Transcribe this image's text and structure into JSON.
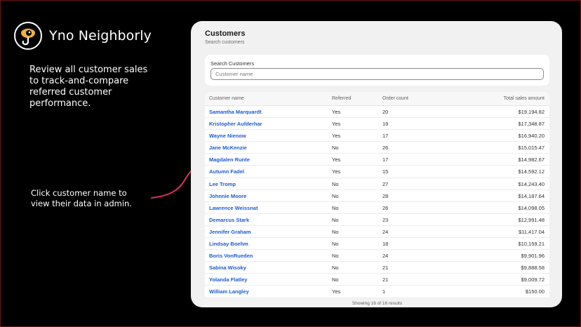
{
  "brand": {
    "name": "Yno Neighborly"
  },
  "intro": {
    "text": "Review all customer sales to track-and-compare referred customer performance."
  },
  "hint": {
    "text": "Click customer name to view their data in admin."
  },
  "panel": {
    "title": "Customers",
    "subtitle": "Search customers",
    "search": {
      "label": "Search Customers",
      "placeholder": "Customer name",
      "value": ""
    },
    "table": {
      "headers": [
        "Customer name",
        "Referred",
        "Order count",
        "Total sales amount"
      ],
      "rows": [
        [
          "Samantha Marquardt",
          "Yes",
          "20",
          "$19,194.82"
        ],
        [
          "Kristopher Aufderhar",
          "Yes",
          "19",
          "$17,348.87"
        ],
        [
          "Wayne Nienow",
          "Yes",
          "17",
          "$16,940.20"
        ],
        [
          "Jane McKenzie",
          "No",
          "26",
          "$15,015.47"
        ],
        [
          "Magdalen Runte",
          "Yes",
          "17",
          "$14,982.67"
        ],
        [
          "Autumn Fadel",
          "Yes",
          "15",
          "$14,592.12"
        ],
        [
          "Lee Tromp",
          "No",
          "27",
          "$14,243.40"
        ],
        [
          "Johnnie Moore",
          "No",
          "28",
          "$14,187.64"
        ],
        [
          "Lawrence Weissnat",
          "No",
          "26",
          "$14,098.05"
        ],
        [
          "Demarcus Stark",
          "No",
          "23",
          "$12,991.48"
        ],
        [
          "Jennifer Graham",
          "No",
          "24",
          "$11,417.04"
        ],
        [
          "Lindsay Boehm",
          "No",
          "18",
          "$10,159.21"
        ],
        [
          "Boris VonRueden",
          "No",
          "24",
          "$9,901.96"
        ],
        [
          "Sabina Wisoky",
          "No",
          "21",
          "$9,888.58"
        ],
        [
          "Yolanda Flatley",
          "No",
          "21",
          "$9,009.72"
        ],
        [
          "William Langley",
          "Yes",
          "1",
          "$150.00"
        ]
      ],
      "footer": "Showing 16 of 16 results"
    }
  },
  "colors": {
    "background": "#000000",
    "panel": "#f1f1f1",
    "link": "#1a5cd6",
    "accent_arrow": "#e8315a",
    "logo_eye": "#f2b233"
  },
  "icons": {
    "logo": "eye-hook-logo-icon",
    "annotation": "curved-arrow-icon"
  }
}
